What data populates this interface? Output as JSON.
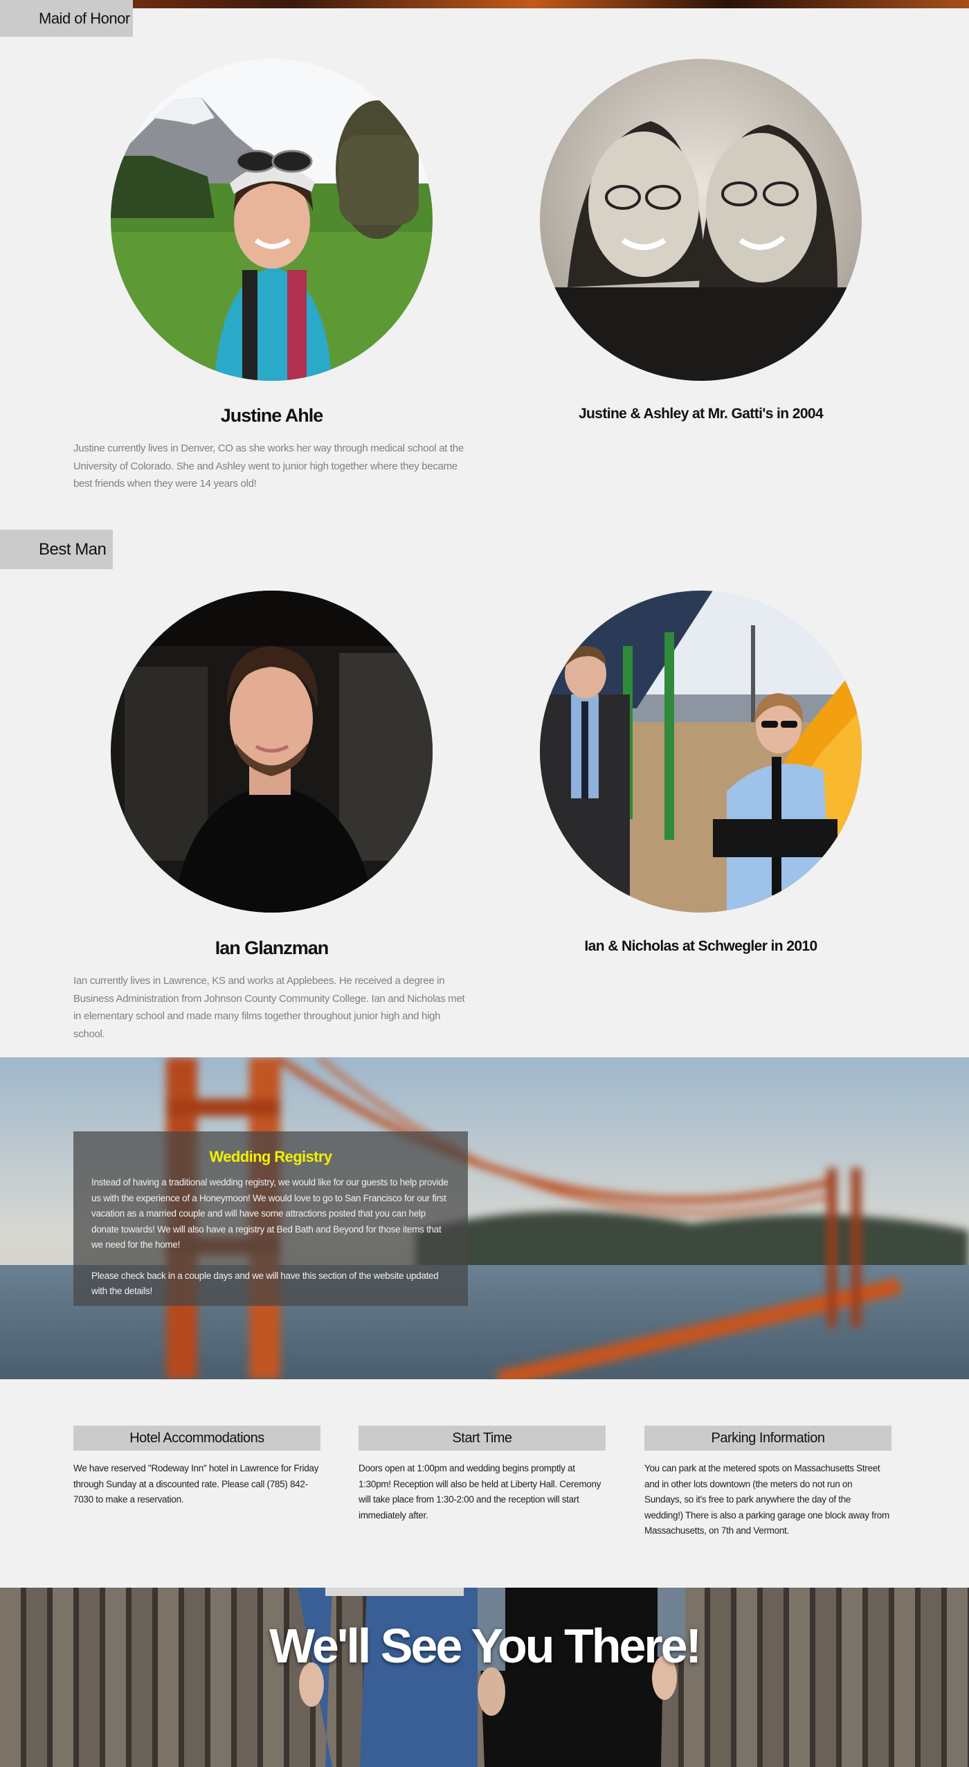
{
  "maid_of_honor": {
    "section_label": "Maid of Honor",
    "name": "Justine Ahle",
    "bio": "Justine currently lives in Denver, CO as she works her way through medical school at the University of Colorado. She and Ashley went to junior high together where they became best friends when they were 14 years old!",
    "photo_caption": "Justine & Ashley at Mr. Gatti's in 2004"
  },
  "best_man": {
    "section_label": "Best Man",
    "name": "Ian Glanzman",
    "bio": "Ian currently lives in Lawrence, KS and works at Applebees. He received a degree in Business Administration from Johnson County Community College. Ian and Nicholas met in elementary school and made many films together throughout junior high and high school.",
    "photo_caption": "Ian & Nicholas at Schwegler in 2010"
  },
  "registry": {
    "title": "Wedding Registry",
    "paragraph_1": "Instead of having a traditional wedding registry, we would like for our guests to help provide us with the experience of a Honeymoon! We would love to go to San Francisco for our first vacation as a married couple and will have some attractions posted that you can help donate towards! We will also have a registry at Bed Bath and Beyond for those items that we need for the home!",
    "paragraph_2": "Please check back in a couple days and we will have this section of the website updated with the details!"
  },
  "info": {
    "hotel": {
      "heading": "Hotel Accommodations",
      "text": "We have reserved \"Rodeway Inn\" hotel in Lawrence for Friday through Sunday at a discounted rate. Please call (785) 842-7030 to make a reservation."
    },
    "start_time": {
      "heading": "Start Time",
      "text": "Doors open at 1:00pm and wedding begins promptly at 1:30pm! Reception will also be held at Liberty Hall. Ceremony will take place from 1:30-2:00 and the reception will start immediately after."
    },
    "parking": {
      "heading": "Parking Information",
      "text": "You can park at the metered spots on Massachusetts Street and in other lots downtown (the meters do not run on Sundays, so it's free to park anywhere the day of the wedding!) There is also a parking garage one block away from Massachusetts, on 7th and Vermont."
    }
  },
  "footer": {
    "title": "We'll See You There!"
  }
}
